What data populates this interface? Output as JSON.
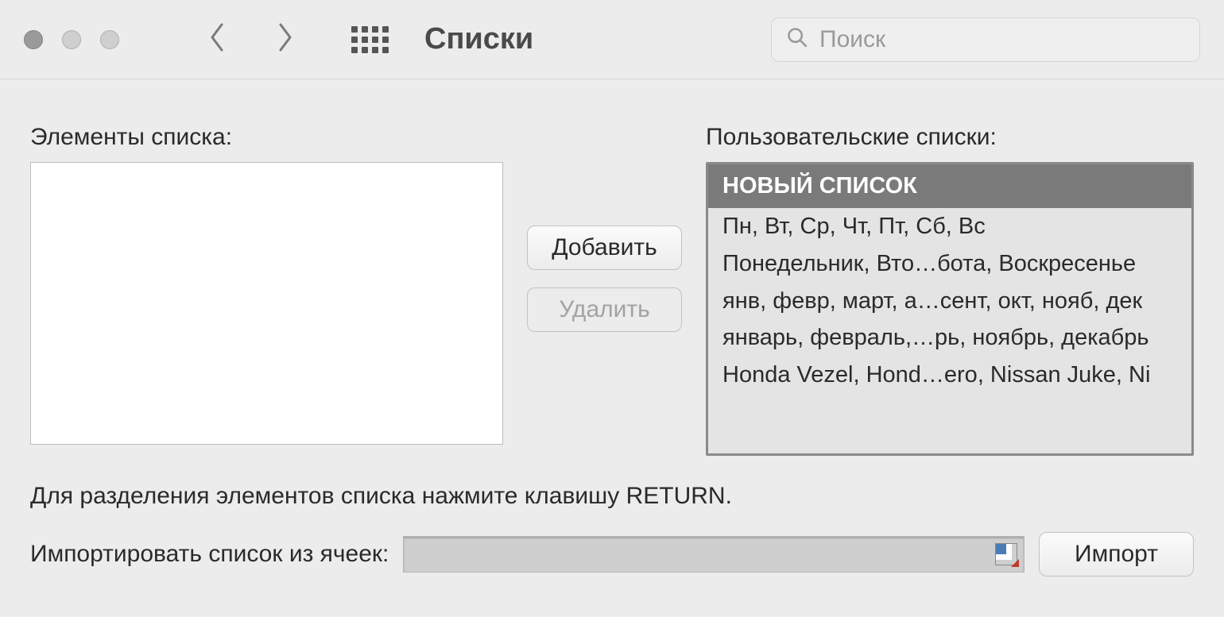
{
  "toolbar": {
    "title": "Списки",
    "search_placeholder": "Поиск"
  },
  "left": {
    "label": "Элементы списка:"
  },
  "buttons": {
    "add": "Добавить",
    "remove": "Удалить",
    "import": "Импорт"
  },
  "right": {
    "label": "Пользовательские списки:",
    "items": [
      "НОВЫЙ СПИСОК",
      "Пн, Вт, Ср, Чт, Пт, Сб, Вс",
      "Понедельник, Вто…бота, Воскресенье",
      "янв, февр, март, а…сент, окт, нояб, дек",
      "январь, февраль,…рь, ноябрь, декабрь",
      "Honda Vezel, Hond…ero, Nissan Juke, Ni"
    ],
    "selected_index": 0
  },
  "helper_text": "Для разделения элементов списка нажмите клавишу RETURN.",
  "import_label": "Импортировать список из ячеек:"
}
